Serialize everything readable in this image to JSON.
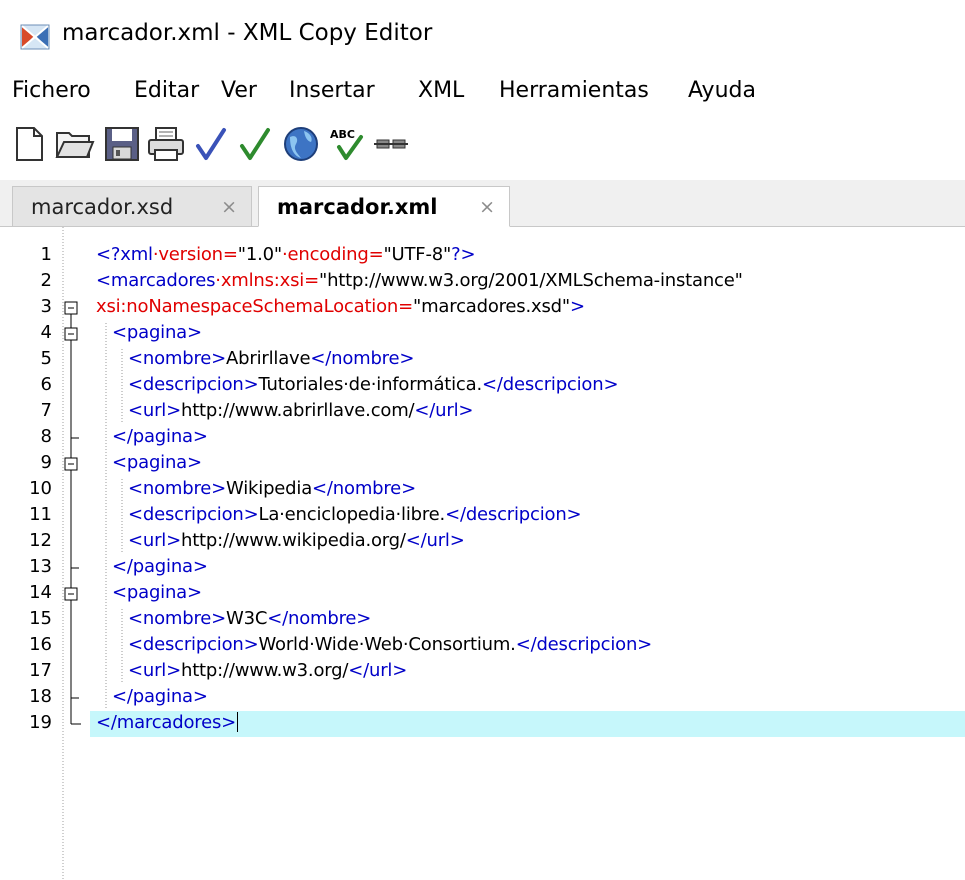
{
  "window": {
    "title": "marcador.xml - XML Copy Editor"
  },
  "menu": [
    "Fichero",
    "Editar",
    "Ver",
    "Insertar",
    "XML",
    "Herramientas",
    "Ayuda"
  ],
  "toolbar": {
    "icons": [
      "new-file-icon",
      "open-folder-icon",
      "save-icon",
      "print-icon",
      "check-wellformed-icon",
      "validate-icon",
      "browser-icon",
      "spellcheck-icon",
      "pretty-print-icon"
    ],
    "spell_label": "ABC"
  },
  "tabs": [
    {
      "label": "marcador.xsd",
      "close": "×",
      "active": false
    },
    {
      "label": "marcador.xml",
      "close": "×",
      "active": true
    }
  ],
  "editor": {
    "current_line": 19,
    "lines": [
      "<?xml·version=\"1.0\"·encoding=\"UTF-8\"?>",
      "<marcadores·xmlns:xsi=\"http://www.w3.org/2001/XMLSchema-instance\"",
      "xsi:noNamespaceSchemaLocation=\"marcadores.xsd\">",
      "<pagina>",
      "<nombre>Abrirllave</nombre>",
      "<descripcion>Tutoriales·de·informática.</descripcion>",
      "<url>http://www.abrirllave.com/</url>",
      "</pagina>",
      "<pagina>",
      "<nombre>Wikipedia</nombre>",
      "<descripcion>La·enciclopedia·libre.</descripcion>",
      "<url>http://www.wikipedia.org/</url>",
      "</pagina>",
      "<pagina>",
      "<nombre>W3C</nombre>",
      "<descripcion>World·Wide·Web·Consortium.</descripcion>",
      "<url>http://www.w3.org/</url>",
      "</pagina>",
      "</marcadores>"
    ]
  },
  "colors": {
    "tag": "#0000c8",
    "attribute": "#e00000",
    "value": "#000000",
    "current_line": "#c6f7fb"
  }
}
